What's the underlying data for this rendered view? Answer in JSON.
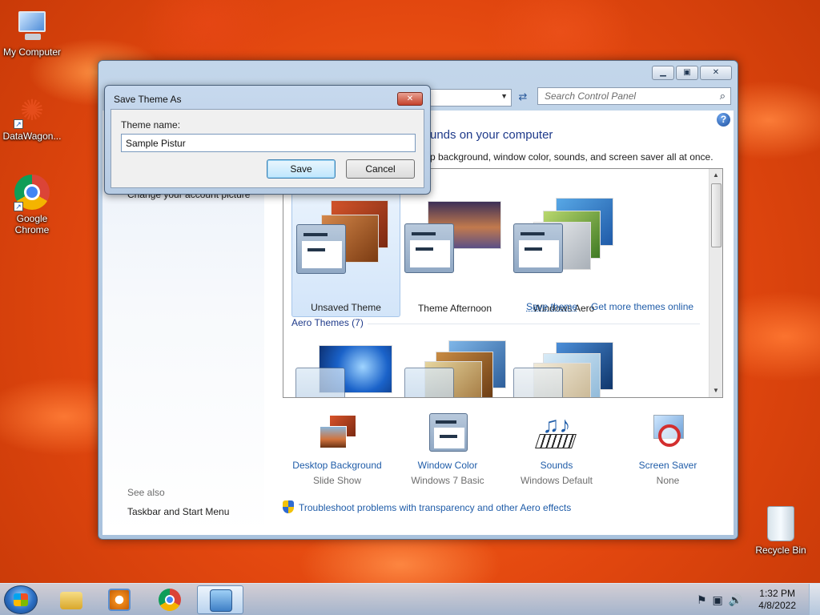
{
  "desktop": {
    "icons": [
      {
        "label": "My Computer"
      },
      {
        "label": "DataWagon..."
      },
      {
        "label": "Google Chrome"
      },
      {
        "label": "Recycle Bin"
      }
    ]
  },
  "window": {
    "search_placeholder": "Search Control Panel",
    "help_glyph": "?",
    "sidebar": {
      "partial_link": "Change your account picture",
      "see_also_title": "See also",
      "see_also_links": [
        "Taskbar and Start Menu"
      ]
    },
    "heading_partial": "unds on your computer",
    "subheading_partial": "p background, window color, sounds, and screen saver all at once.",
    "my_themes": [
      {
        "label": "Unsaved Theme",
        "selected": true
      },
      {
        "label": "Theme Afternoon",
        "selected": false
      },
      {
        "label": "Windows Aero",
        "selected": false
      }
    ],
    "save_theme_link": "Save theme",
    "get_more_link": "Get more themes online",
    "aero_group_title": "Aero Themes (7)",
    "bottom_items": [
      {
        "title": "Desktop Background",
        "value": "Slide Show",
        "icon": "desktop-background-icon"
      },
      {
        "title": "Window Color",
        "value": "Windows 7 Basic",
        "icon": "window-color-icon"
      },
      {
        "title": "Sounds",
        "value": "Windows Default",
        "icon": "sounds-icon"
      },
      {
        "title": "Screen Saver",
        "value": "None",
        "icon": "screen-saver-icon"
      }
    ],
    "troubleshoot_link": "Troubleshoot problems with transparency and other Aero effects"
  },
  "dialog": {
    "title": "Save Theme As",
    "field_label": "Theme name:",
    "field_value": "Sample Pistur",
    "save_label": "Save",
    "cancel_label": "Cancel"
  },
  "taskbar": {
    "time": "1:32 PM",
    "date": "4/8/2022"
  }
}
